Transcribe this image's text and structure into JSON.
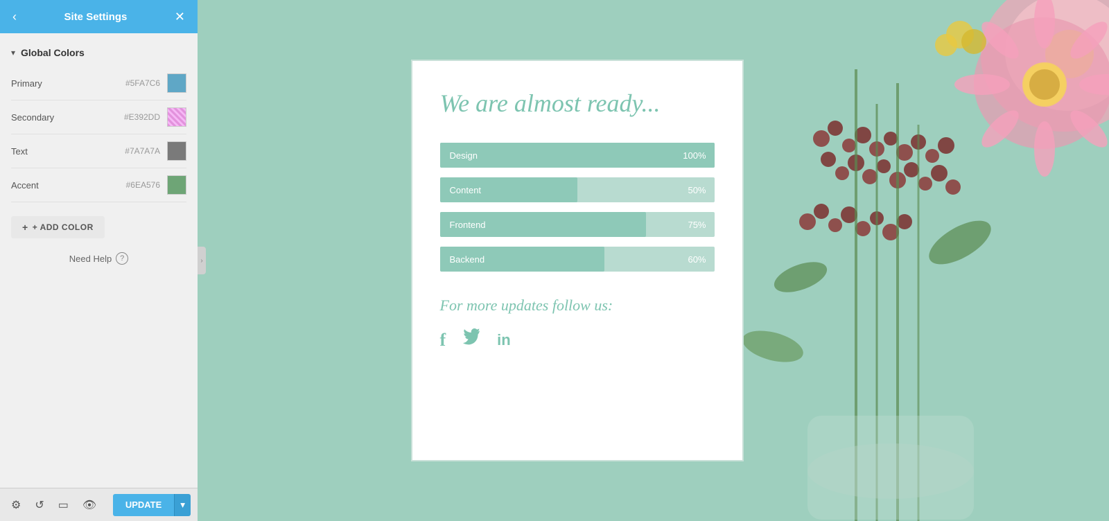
{
  "sidebar": {
    "title": "Site Settings",
    "back_label": "‹",
    "close_label": "✕",
    "global_colors_label": "Global Colors",
    "colors": [
      {
        "id": "primary",
        "label": "Primary",
        "hex": "#5FA7C6",
        "swatch": "#5FA7C6"
      },
      {
        "id": "secondary",
        "label": "Secondary",
        "hex": "#E392DD",
        "swatch": "#E392DD"
      },
      {
        "id": "text",
        "label": "Text",
        "hex": "#7A7A7A",
        "swatch": "#7A7A7A"
      },
      {
        "id": "accent",
        "label": "Accent",
        "hex": "#6EA576",
        "swatch": "#6EA576"
      }
    ],
    "add_color_label": "+ ADD COLOR",
    "need_help_label": "Need Help",
    "update_label": "UPDATE"
  },
  "preview": {
    "title": "We are almost ready...",
    "progress_items": [
      {
        "label": "Design",
        "percent": 100,
        "display": "100%"
      },
      {
        "label": "Content",
        "percent": 50,
        "display": "50%"
      },
      {
        "label": "Frontend",
        "percent": 75,
        "display": "75%"
      },
      {
        "label": "Backend",
        "percent": 60,
        "display": "60%"
      }
    ],
    "footer_title": "For more updates follow us:",
    "social_icons": [
      "f",
      "𝕥",
      "in"
    ]
  },
  "toolbar": {
    "settings_icon": "⚙",
    "history_icon": "↺",
    "preview_icon": "▭",
    "eye_icon": "👁",
    "update_label": "UPDATE",
    "dropdown_icon": "▾"
  }
}
